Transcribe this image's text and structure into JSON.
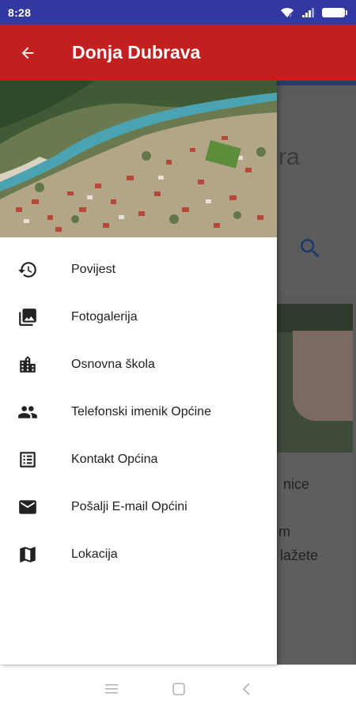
{
  "status_bar": {
    "time": "8:28",
    "icons": [
      "wifi-icon",
      "signal-icon",
      "battery-icon"
    ]
  },
  "app_bar": {
    "title": "Donja Dubrava",
    "back_icon": "arrow-back-icon"
  },
  "drawer": {
    "header_image": "aerial-town-photo",
    "items": [
      {
        "label": "Povijest",
        "icon": "history-icon"
      },
      {
        "label": "Fotogalerija",
        "icon": "photo-library-icon"
      },
      {
        "label": "Osnovna škola",
        "icon": "building-icon"
      },
      {
        "label": "Telefonski imenik Općine",
        "icon": "people-icon"
      },
      {
        "label": "Kontakt Općina",
        "icon": "list-icon"
      },
      {
        "label": "Pošalji E-mail Općini",
        "icon": "mail-icon"
      },
      {
        "label": "Lokacija",
        "icon": "map-icon"
      }
    ]
  },
  "background": {
    "partial_text_1": "ra",
    "partial_text_2": "nice",
    "partial_text_3": "m",
    "partial_text_4": "lažete"
  },
  "colors": {
    "status_bar": "#3338a0",
    "app_bar": "#c21f1f",
    "accent_blue": "#1565c0"
  },
  "nav_bar": {
    "icons": [
      "menu-icon",
      "home-square-icon",
      "back-chevron-icon"
    ]
  }
}
